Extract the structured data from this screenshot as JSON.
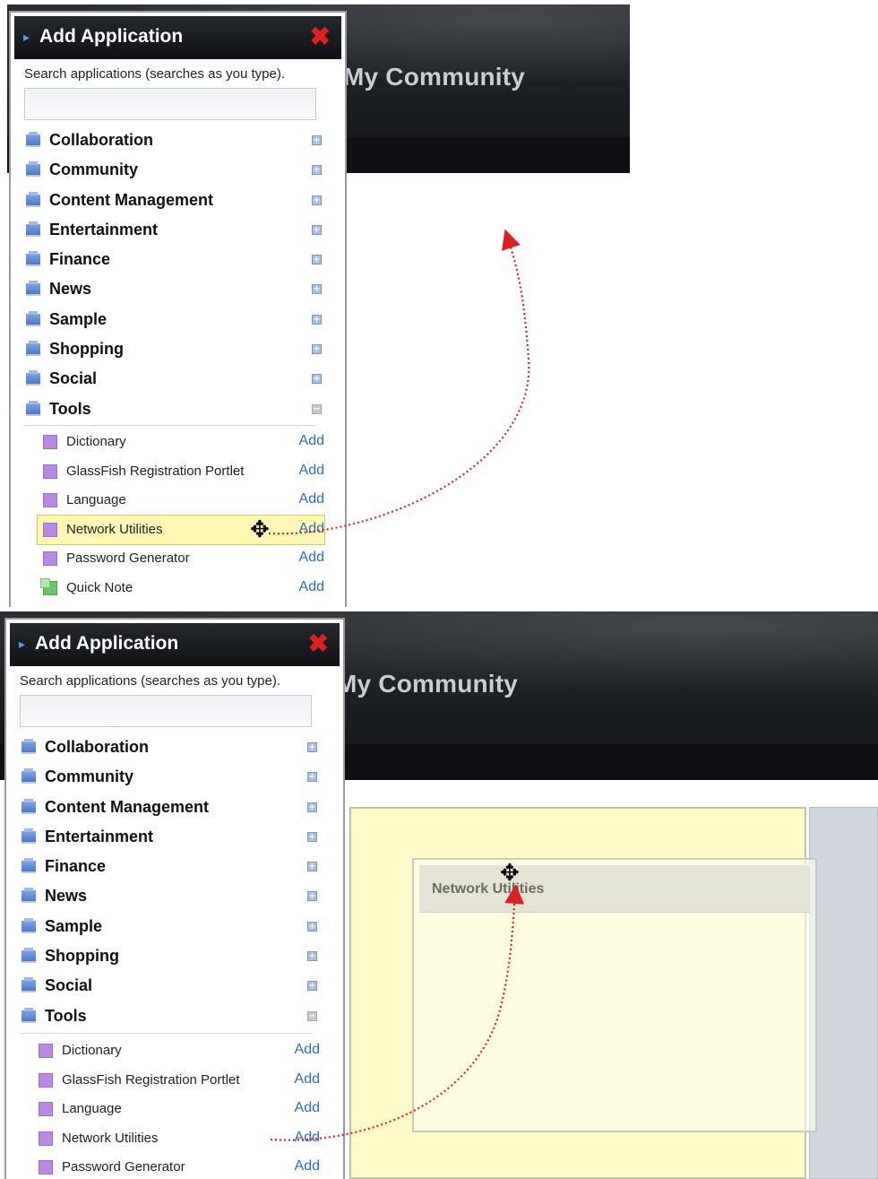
{
  "community_title": "My Community",
  "panel": {
    "title": "Add Application",
    "close_icon": "✖",
    "search_label": "Search applications (searches as you type).",
    "search_value": ""
  },
  "categories": [
    {
      "label": "Collaboration",
      "expanded": false
    },
    {
      "label": "Community",
      "expanded": false
    },
    {
      "label": "Content Management",
      "expanded": false
    },
    {
      "label": "Entertainment",
      "expanded": false
    },
    {
      "label": "Finance",
      "expanded": false
    },
    {
      "label": "News",
      "expanded": false
    },
    {
      "label": "Sample",
      "expanded": false
    },
    {
      "label": "Shopping",
      "expanded": false
    },
    {
      "label": "Social",
      "expanded": false
    },
    {
      "label": "Tools",
      "expanded": true
    }
  ],
  "tools_apps": [
    {
      "name": "Dictionary",
      "action": "Add",
      "icon": "purple-square-icon"
    },
    {
      "name": "GlassFish Registration Portlet",
      "action": "Add",
      "icon": "purple-square-icon"
    },
    {
      "name": "Language",
      "action": "Add",
      "icon": "purple-square-icon"
    },
    {
      "name": "Network Utilities",
      "action": "Add",
      "icon": "purple-square-icon"
    },
    {
      "name": "Password Generator",
      "action": "Add",
      "icon": "purple-square-icon"
    },
    {
      "name": "Quick Note",
      "action": "Add",
      "icon": "green-note-icon"
    }
  ],
  "dragged_portlet": "Network Utilities",
  "colors": {
    "accent_blue": "#2a6fbe",
    "drag_arrow": "#e02020",
    "highlight": "#fff8b4",
    "drop_zone": "#fffbc8",
    "side_column": "#d2d7de"
  }
}
